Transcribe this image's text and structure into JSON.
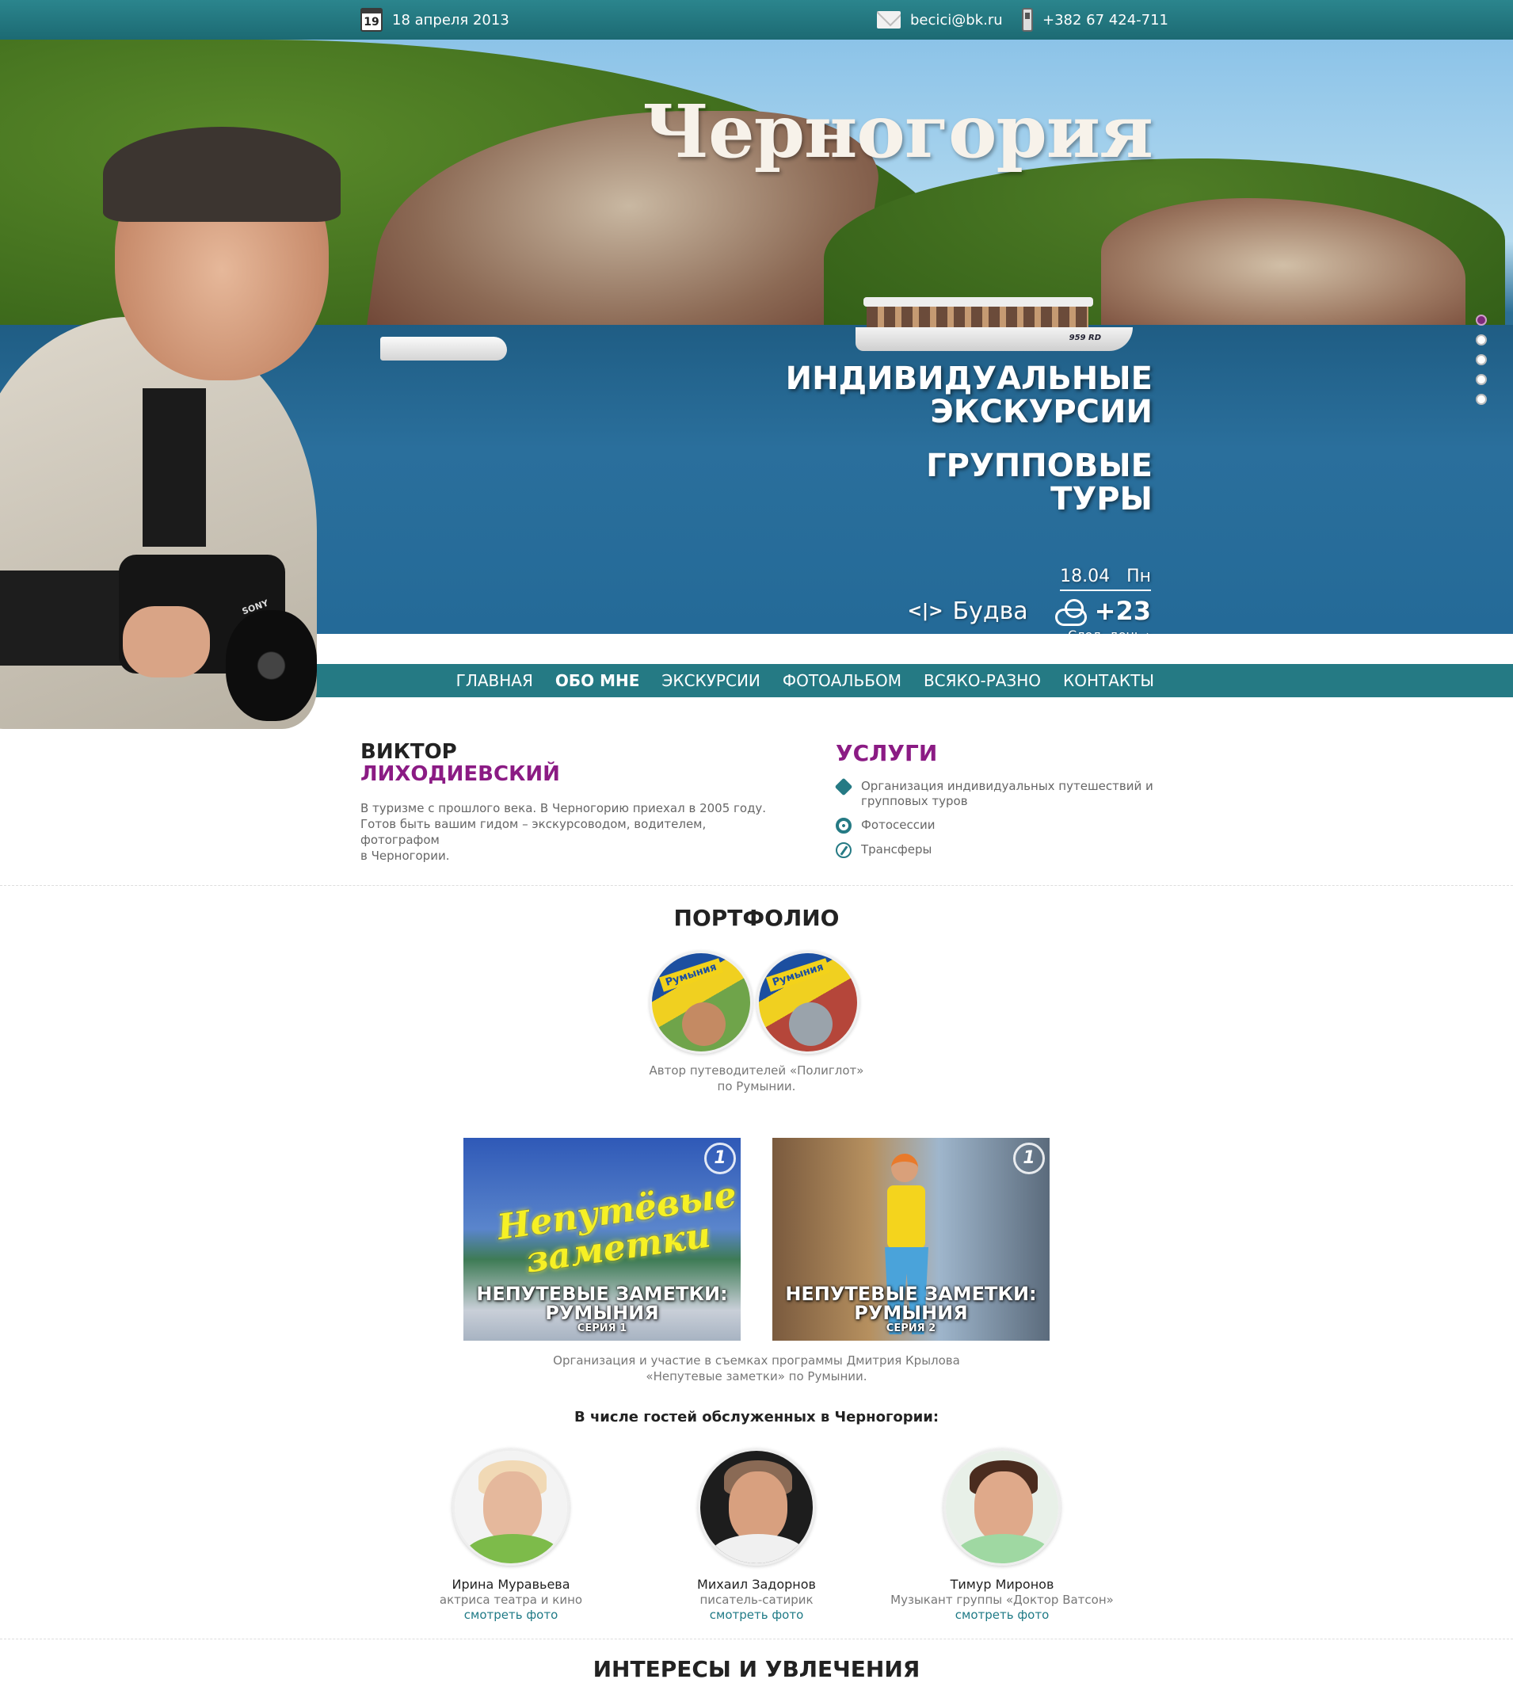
{
  "topbar": {
    "calendar_day": "19",
    "date": "18 апреля 2013",
    "email": "becici@bk.ru",
    "phone": "+382 67 424-711"
  },
  "hero": {
    "title": "Черногория",
    "slogan1": [
      "ИНДИВИДУАЛЬНЫЕ",
      "ЭКСКУРСИИ"
    ],
    "slogan2": [
      "ГРУППОВЫЕ",
      "ТУРЫ"
    ],
    "boat_number": "959 RD",
    "camera_brand": "SONY",
    "slider": {
      "count": 5,
      "active": 1
    }
  },
  "weather": {
    "date": "18.04",
    "weekday": "Пн",
    "city_icon": "code-brackets-icon",
    "city": "Будва",
    "condition_icon": "partly-cloudy-icon",
    "temp": "+23",
    "next_label": "След. день",
    "next_icon": "chevron-right-icon"
  },
  "nav": [
    "Главная",
    "Обо мне",
    "Экскурсии",
    "Фотоальбом",
    "Всяко-разно",
    "Контакты"
  ],
  "nav_active": 1,
  "about": {
    "first_name": "ВИКТОР",
    "last_name": "ЛИХОДИЕВСКИЙ",
    "text": [
      "В туризме с прошлого века. В Черногорию приехал в 2005 году.",
      "Готов быть вашим гидом – экскурсоводом, водителем, фотографом",
      "в  Черногории."
    ]
  },
  "services": {
    "title": "УСЛУГИ",
    "items": [
      {
        "icon": "tag-icon",
        "label": [
          "Организация индивидуальных путешествий и",
          "групповых туров"
        ]
      },
      {
        "icon": "camera-shutter-icon",
        "label": [
          "Фотосессии"
        ]
      },
      {
        "icon": "compass-icon",
        "label": [
          "Трансферы"
        ]
      }
    ]
  },
  "portfolio": {
    "title": "ПОРТФОЛИО",
    "book_label": "Румыния",
    "books_caption": [
      "Автор путеводителей «Полиглот»",
      "по Румынии."
    ],
    "videos": [
      {
        "neon": [
          "Непутёвые",
          "заметки"
        ],
        "title": [
          "НЕПУТЕВЫЕ ЗАМЕТКИ:",
          "РУМЫНИЯ"
        ],
        "series": "СЕРИЯ 1",
        "channel": "1"
      },
      {
        "title": [
          "НЕПУТЕВЫЕ ЗАМЕТКИ:",
          "РУМЫНИЯ"
        ],
        "series": "СЕРИЯ 2",
        "channel": "1"
      }
    ],
    "videos_caption": [
      "Организация и участие в съемках программы Дмитрия Крылова",
      "«Непутевые заметки» по Румынии."
    ]
  },
  "guests": {
    "title": "В числе гостей обслуженных в Черногории:",
    "items": [
      {
        "name": "Ирина Муравьева",
        "role": "актриса театра и кино",
        "link": "смотреть фото"
      },
      {
        "name": "Михаил Задорнов",
        "role": "писатель-сатирик",
        "link": "смотреть фото"
      },
      {
        "name": "Тимур Миронов",
        "role": "Музыкант группы «Доктор Ватсон»",
        "link": "смотреть фото"
      }
    ]
  },
  "interests": {
    "title": "ИНТЕРЕСЫ И УВЛЕЧЕНИЯ"
  },
  "colors": {
    "teal": "#257a84",
    "purple": "#8b1b84"
  }
}
